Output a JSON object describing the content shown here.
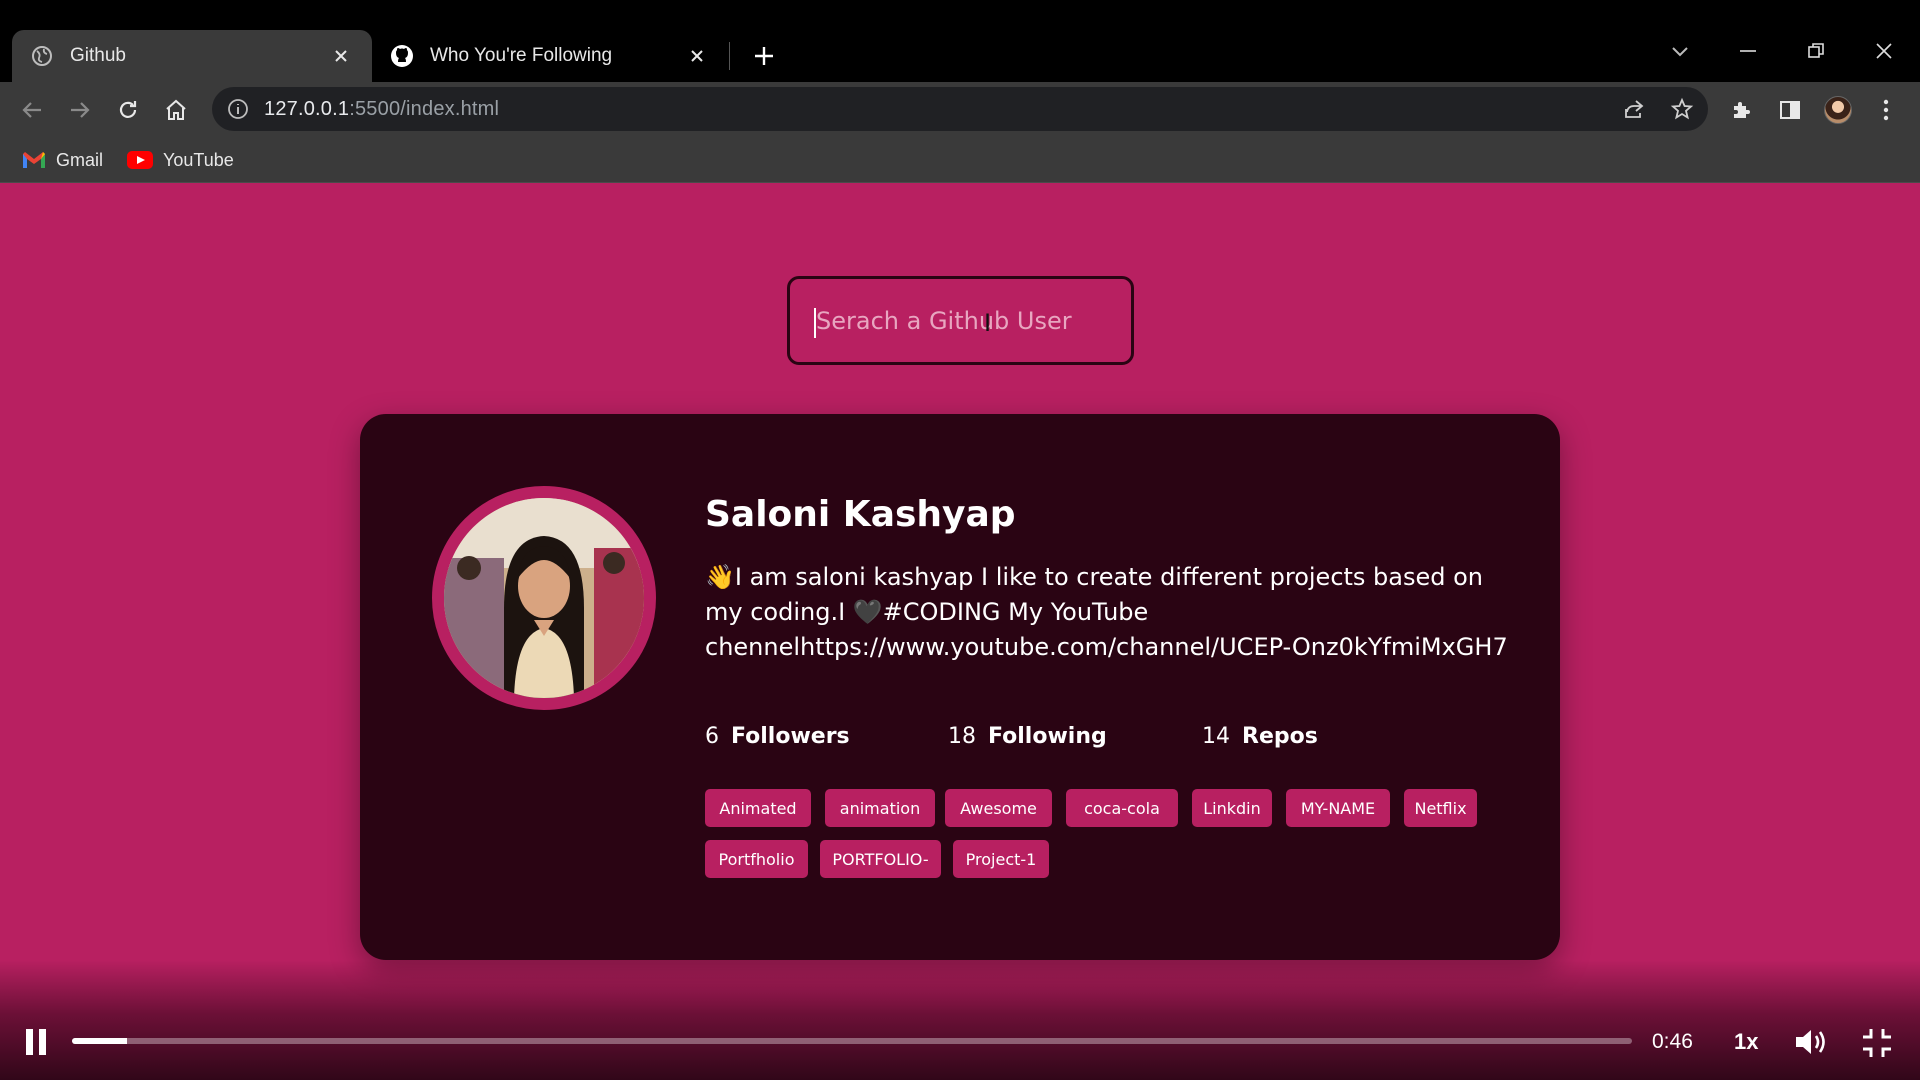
{
  "browser": {
    "tabs": [
      {
        "title": "Github",
        "active": true,
        "icon": "globe-icon"
      },
      {
        "title": "Who You're Following",
        "active": false,
        "icon": "github-icon"
      }
    ],
    "url_host": "127.0.0.1",
    "url_rest": ":5500/index.html",
    "bookmarks": [
      {
        "label": "Gmail",
        "icon": "gmail-icon"
      },
      {
        "label": "YouTube",
        "icon": "youtube-icon"
      }
    ]
  },
  "search": {
    "placeholder": "Serach a Github User"
  },
  "profile": {
    "name": "Saloni Kashyap",
    "bio": "👋I am saloni kashyap I like to create different projects based on my coding.I 🖤#CODING My YouTube chennelhttps://www.youtube.com/channel/UCEP-Onz0kYfmiMxGH7",
    "stats": [
      {
        "value": "6",
        "label": "Followers"
      },
      {
        "value": "18",
        "label": "Following"
      },
      {
        "value": "14",
        "label": "Repos"
      }
    ],
    "repos": [
      "Animated",
      "animation",
      "Awesome",
      "coca-cola",
      "Linkdin",
      "MY-NAME",
      "Netflix",
      "Portfholio",
      "PORTFOLIO-",
      "Project-1"
    ]
  },
  "video": {
    "time": "0:46",
    "speed": "1x",
    "progress_fraction": 0.035
  },
  "colors": {
    "page_bg": "#b82061",
    "card_bg": "#2a0413",
    "accent": "#b82061"
  }
}
